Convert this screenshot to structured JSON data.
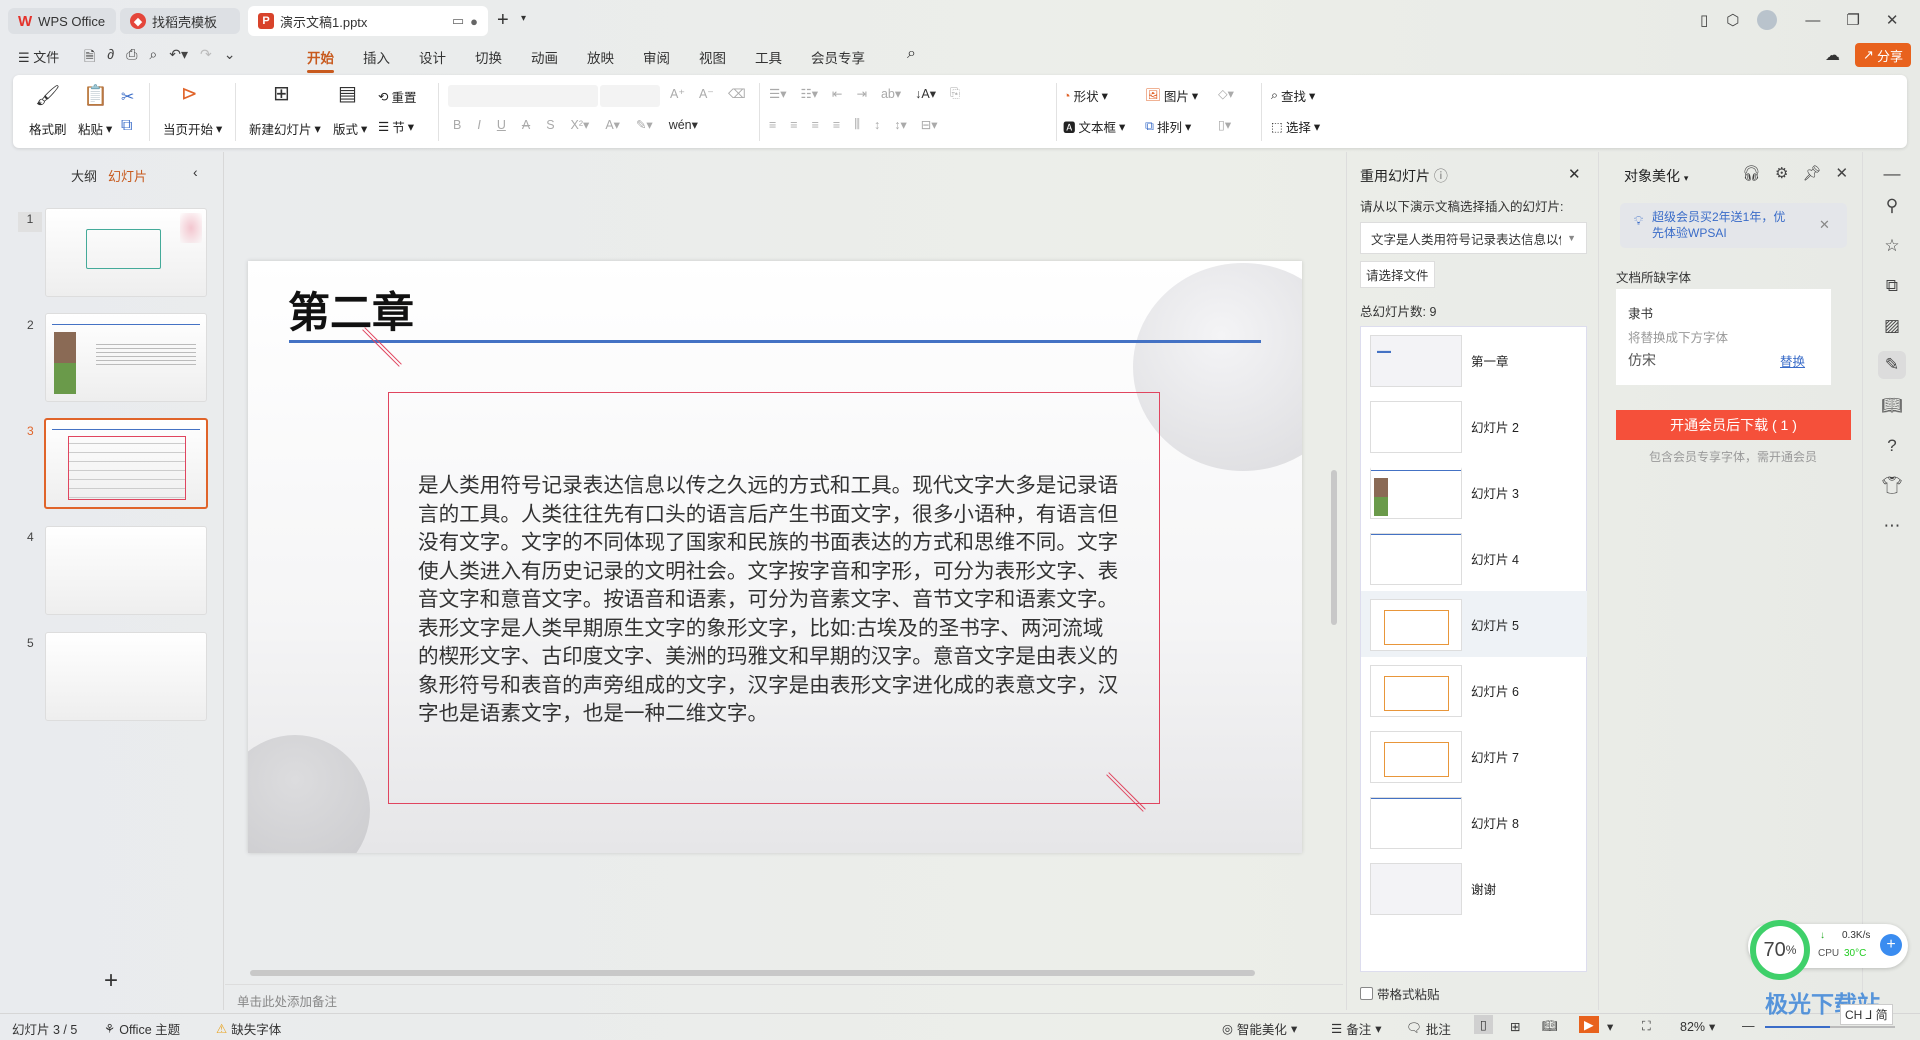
{
  "tabs": [
    {
      "label": "WPS Office"
    },
    {
      "label": "找稻壳模板"
    },
    {
      "label": "演示文稿1.pptx"
    }
  ],
  "menu": {
    "file": "文件",
    "items": [
      "开始",
      "插入",
      "设计",
      "切换",
      "动画",
      "放映",
      "审阅",
      "视图",
      "工具",
      "会员专享"
    ],
    "active": "开始",
    "share": "分享"
  },
  "ribbon": {
    "format_painter": "格式刷",
    "paste": "粘贴",
    "play_current": "当页开始",
    "new_slide": "新建幻灯片",
    "layout": "版式",
    "reset": "重置",
    "section": "节",
    "shape": "形状",
    "textbox": "文本框",
    "picture": "图片",
    "arrange": "排列",
    "find": "查找",
    "select": "选择"
  },
  "left_panel": {
    "tab_outline": "大纲",
    "tab_slides": "幻灯片",
    "active_tab": "幻灯片",
    "slides": [
      "1",
      "2",
      "3",
      "4",
      "5"
    ],
    "selected": 3,
    "add": "+"
  },
  "slide": {
    "title": "第二章",
    "body_lines": [
      "是人类用符号记录表达信息以传之久远的方式和工具。现代文字大多是记录语",
      "言的工具。人类往往先有口头的语言后产生书面文字，很多小语种，有语言但",
      "没有文字。文字的不同体现了国家和民族的书面表达的方式和思维不同。文字",
      "使人类进入有历史记录的文明社会。文字按字音和字形，可分为表形文字、表",
      "音文字和意音文字。按语音和语素，可分为音素文字、音节文字和语素文字。",
      "表形文字是人类早期原生文字的象形文字，比如:古埃及的圣书字、两河流域",
      "的楔形文字、古印度文字、美洲的玛雅文和早期的汉字。意音文字是由表义的",
      "象形符号和表音的声旁组成的文字，汉字是由表形文字进化成的表意文字，汉",
      "字也是语素文字，也是一种二维文字。"
    ],
    "accent_blue": "#4472c4",
    "box_red": "#e0455f"
  },
  "notes_placeholder": "单击此处添加备注",
  "reuse_panel": {
    "title": "重用幻灯片",
    "subtitle": "请从以下演示文稿选择插入的幻灯片:",
    "dropdown_value": "文字是人类用符号记录表达信息以传",
    "choose_file": "请选择文件",
    "total": "总幻灯片数: 9",
    "items": [
      "第一章",
      "幻灯片 2",
      "幻灯片 3",
      "幻灯片 4",
      "幻灯片 5",
      "幻灯片 6",
      "幻灯片 7",
      "幻灯片 8",
      "谢谢"
    ],
    "hovered": "幻灯片 5",
    "keep_format": "带格式粘贴"
  },
  "beautify_panel": {
    "title": "对象美化",
    "promo": "超级会员买2年送1年，优先体验WPSAI",
    "missing_fonts_label": "文档所缺字体",
    "font_name": "隶书",
    "replace_hint": "将替换成下方字体",
    "replacement": "仿宋",
    "replace_link": "替换",
    "download_button": "开通会员后下载 ( 1 )",
    "note": "包含会员专享字体，需开通会员",
    "button_color": "#f5503a"
  },
  "status_bar": {
    "slide_counter": "幻灯片 3 / 5",
    "theme": "Office 主题",
    "missing_font": "缺失字体",
    "smart": "智能美化",
    "notes": "备注",
    "comments": "批注",
    "zoom": "82%"
  },
  "widget": {
    "percent": "70",
    "unit": "%",
    "net": "0.3K/s",
    "cpu_label": "CPU",
    "cpu_temp": "30°C",
    "ime": "CH ⅃ 简"
  },
  "watermark": "极光下载站"
}
